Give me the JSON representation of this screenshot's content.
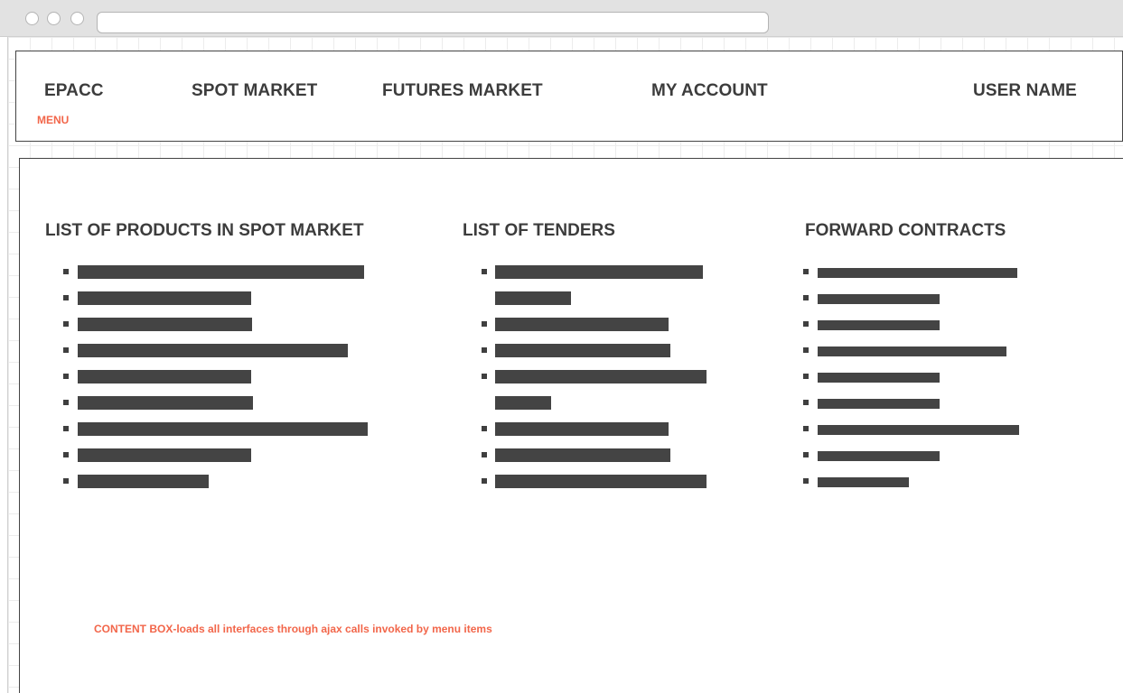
{
  "header": {
    "brand": "EPACC",
    "menu_label": "MENU",
    "nav_items": [
      "SPOT MARKET",
      "FUTURES MARKET",
      "MY ACCOUNT"
    ],
    "user_name": "USER NAME"
  },
  "content": {
    "columns": [
      {
        "title": "LIST OF PRODUCTS IN SPOT MARKET",
        "item_count": 9
      },
      {
        "title": "LIST OF TENDERS",
        "item_count": 7
      },
      {
        "title": "FORWARD CONTRACTS",
        "item_count": 9
      }
    ],
    "note": "CONTENT BOX-loads all interfaces through ajax calls invoked by menu items"
  },
  "colors": {
    "text_dark": "#3c3c3c",
    "annotation": "#f2664a",
    "placeholder_bar": "#444444"
  }
}
